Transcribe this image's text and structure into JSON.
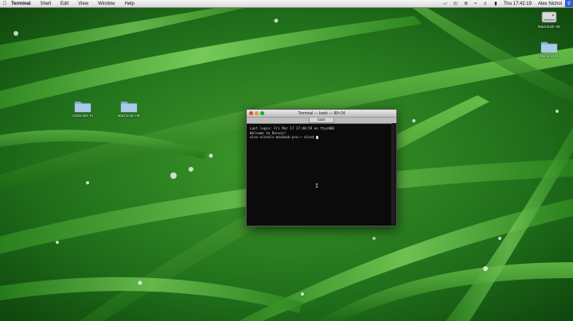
{
  "menubar": {
    "app_name": "Terminal",
    "items": [
      "Shell",
      "Edit",
      "View",
      "Window",
      "Help"
    ],
    "clock": "Thu 17:42:19",
    "user": "Alex Nichol"
  },
  "desktop_icons": [
    {
      "label": "Macintosh HD",
      "kind": "drive"
    },
    {
      "label": "Documents",
      "kind": "folder"
    },
    {
      "label": "Subscribe To",
      "kind": "folder"
    },
    {
      "label": "Machoods HD",
      "kind": "folder"
    }
  ],
  "terminal": {
    "title": "Terminal — bash — 80×24",
    "tab_label": "bash",
    "lines": [
      "Last login: Fri Mar 17 17:40:59 on ttys000",
      "Welcome to Darwin!",
      "",
      "alex-nichols-macbook-pro:~ alex$ "
    ]
  },
  "colors": {
    "grass_dark": "#0f4d0c",
    "grass_mid": "#2f8f24",
    "grass_light": "#7fd35e"
  }
}
